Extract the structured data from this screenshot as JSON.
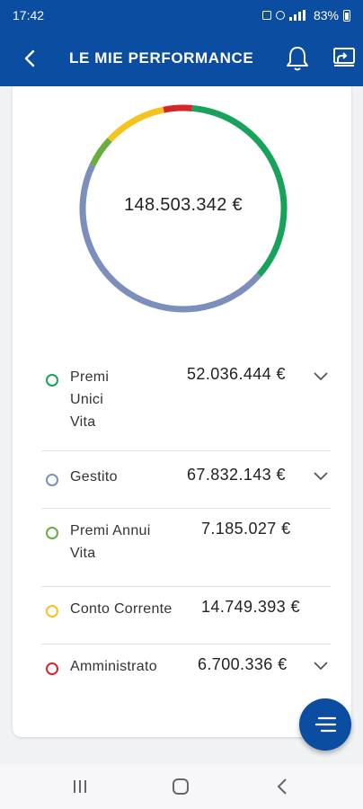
{
  "status_bar": {
    "time": "17:42",
    "battery": "83%"
  },
  "header": {
    "title": "LE MIE PERFORMANCE",
    "back_icon": "chevron-left-icon",
    "notifications_icon": "bell-icon",
    "screen_icon": "screen-share-icon"
  },
  "chart_data": {
    "type": "pie",
    "title": "148.503.342 €",
    "categories": [
      "Premi Unici Vita",
      "Gestito",
      "Premi Annui Vita",
      "Conto Corrente",
      "Amministrato"
    ],
    "values": [
      52036444,
      67832143,
      7185027,
      14749393,
      6700336
    ],
    "colors": [
      "#17a35a",
      "#7b8fba",
      "#6aac3f",
      "#f6c21c",
      "#d5262a"
    ],
    "start": "top-right",
    "style": "ring"
  },
  "items": [
    {
      "label": "Premi Unici Vita",
      "amount": "52.036.444 €",
      "color": "#17a35a",
      "expandable": true
    },
    {
      "label": "Gestito",
      "amount": "67.832.143 €",
      "color": "#7b8fba",
      "expandable": true
    },
    {
      "label": "Premi Annui Vita",
      "amount": "7.185.027 €",
      "color": "#6aac3f",
      "expandable": false
    },
    {
      "label": "Conto Corrente",
      "amount": "14.749.393 €",
      "color": "#f6c21c",
      "expandable": false
    },
    {
      "label": "Amministrato",
      "amount": "6.700.336 €",
      "color": "#d5262a",
      "expandable": true
    }
  ],
  "fab_icon": "menu-lines-icon",
  "colors": {
    "brand": "#0b4da0"
  }
}
